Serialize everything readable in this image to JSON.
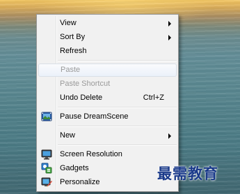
{
  "context_menu": {
    "items": [
      {
        "label": "View",
        "submenu": true
      },
      {
        "label": "Sort By",
        "submenu": true
      },
      {
        "label": "Refresh"
      },
      {
        "label": "Paste",
        "disabled": true,
        "highlighted": true
      },
      {
        "label": "Paste Shortcut",
        "disabled": true
      },
      {
        "label": "Undo Delete",
        "shortcut": "Ctrl+Z"
      },
      {
        "label": "Pause DreamScene",
        "icon": "dreamscene-icon"
      },
      {
        "label": "New",
        "submenu": true
      },
      {
        "label": "Screen Resolution",
        "icon": "monitor-icon"
      },
      {
        "label": "Gadgets",
        "icon": "gadgets-icon"
      },
      {
        "label": "Personalize",
        "icon": "personalize-icon"
      }
    ]
  },
  "watermark": {
    "text": "最需教育"
  }
}
